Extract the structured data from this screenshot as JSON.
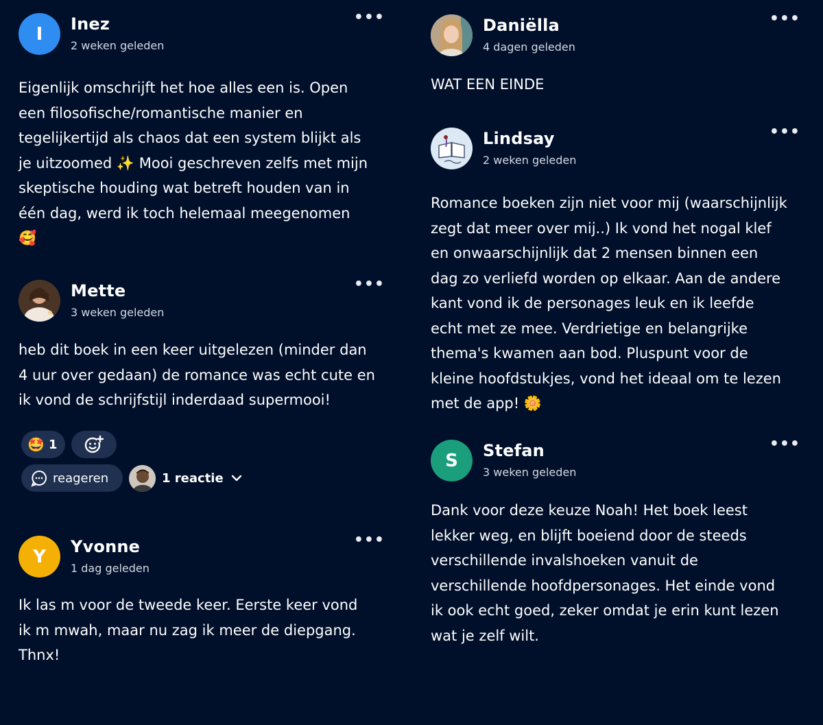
{
  "comments_left": [
    {
      "name": "Inez",
      "time": "2 weken geleden",
      "avatar_letter": "I",
      "avatar_color": "#2f8cf0",
      "text": "Eigenlijk omschrijft het hoe alles een is. Open\neen filosofische/romantische manier en\ntegelijkertijd als chaos dat een system blijkt als\nje uitzoomed ✨ Mooi geschreven zelfs met mijn\nskeptische houding wat betreft houden van in\néén dag, werd ik toch helemaal meegenomen\n🥰"
    },
    {
      "name": "Mette",
      "time": "3 weken geleden",
      "avatar_icon": "photo-avatar-icon",
      "text": "heb dit boek in een keer uitgelezen (minder dan\n4 uur over gedaan) de romance was echt cute en\nik vond de schrijfstijl inderdaad supermooi!"
    },
    {
      "name": "Yvonne",
      "time": "1 dag geleden",
      "avatar_letter": "Y",
      "avatar_color": "#f5b005",
      "text": "Ik las m voor de tweede keer. Eerste keer vond\nik m mwah, maar nu zag ik meer de diepgang.\nThnx!"
    }
  ],
  "comments_right": [
    {
      "name": "Daniëlla",
      "time": "4 dagen geleden",
      "avatar_icon": "photo-avatar-icon",
      "text": "WAT EEN EINDE"
    },
    {
      "name": "Lindsay",
      "time": "2 weken geleden",
      "avatar_icon": "book-logo-avatar-icon",
      "text": "Romance boeken zijn niet voor mij (waarschijnlijk\nzegt dat meer over mij..) Ik vond het nogal klef\nen onwaarschijnlijk dat 2 mensen binnen een\ndag zo verliefd worden op elkaar. Aan de andere\nkant vond ik de personages leuk en ik leefde\necht met ze mee. Verdrietige en belangrijke\nthema's kwamen aan bod. Pluspunt voor de\nkleine hoofdstukjes, vond het ideaal om te lezen\nmet de app! 🌼"
    },
    {
      "name": "Stefan",
      "time": "3 weken geleden",
      "avatar_letter": "S",
      "avatar_color": "#1b9e7c",
      "text": "Dank voor deze keuze Noah! Het boek leest\nlekker weg, en blijft boeiend door de steeds\nverschillende invalshoeken vanuit de\nverschillende hoofdpersonages. Het einde vond\nik ook echt goed, zeker omdat je erin kunt lezen\nwat je zelf wilt."
    }
  ],
  "more_glyph": "•••",
  "reactions": {
    "emoji": "🤩",
    "count": "1",
    "add_reaction_icon": "add-emoji-icon",
    "reply_label": "reageren",
    "replies_label": "1 reactie"
  }
}
